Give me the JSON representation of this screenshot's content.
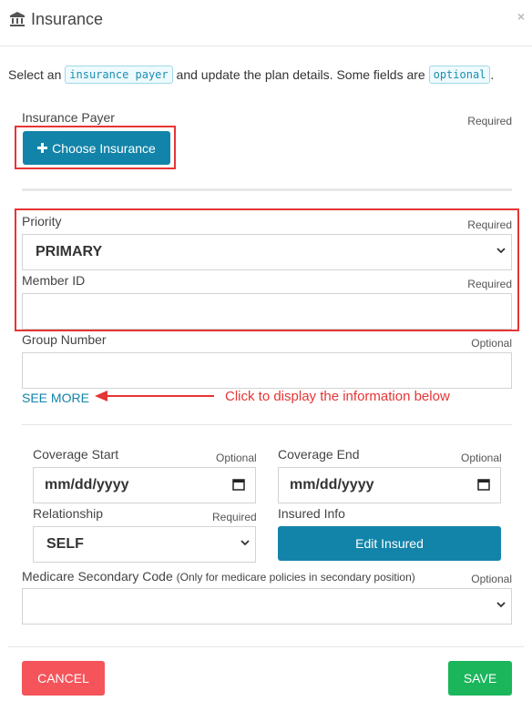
{
  "header": {
    "title": "Insurance",
    "title_icon": "bank-icon",
    "close_label": "×"
  },
  "intro": {
    "part1": "Select an ",
    "code1": "insurance payer",
    "part2": " and update the plan details. Some fields are ",
    "code2": "optional",
    "part3": "."
  },
  "payer": {
    "label": "Insurance Payer",
    "required": "Required",
    "button_label": "Choose Insurance",
    "button_icon": "plus-icon"
  },
  "priority": {
    "label": "Priority",
    "required": "Required",
    "value": "PRIMARY"
  },
  "member_id": {
    "label": "Member ID",
    "required": "Required",
    "value": ""
  },
  "group_number": {
    "label": "Group Number",
    "optional": "Optional",
    "value": ""
  },
  "see_more": {
    "label": "SEE MORE",
    "annotation": "Click to display the information below"
  },
  "coverage_start": {
    "label": "Coverage Start",
    "optional": "Optional",
    "value": "mm/dd/yyyy"
  },
  "coverage_end": {
    "label": "Coverage End",
    "optional": "Optional",
    "value": "mm/dd/yyyy"
  },
  "relationship": {
    "label": "Relationship",
    "required": "Required",
    "value": "SELF"
  },
  "insured_info": {
    "label": "Insured Info",
    "button_label": "Edit Insured"
  },
  "medicare": {
    "label": "Medicare Secondary Code",
    "hint": "(Only for medicare policies in secondary position)",
    "optional": "Optional",
    "value": ""
  },
  "footer": {
    "cancel_label": "CANCEL",
    "save_label": "SAVE"
  },
  "colors": {
    "primary": "#1384a9",
    "danger": "#f4545a",
    "success": "#1bb55c",
    "annotation": "#e53535"
  }
}
